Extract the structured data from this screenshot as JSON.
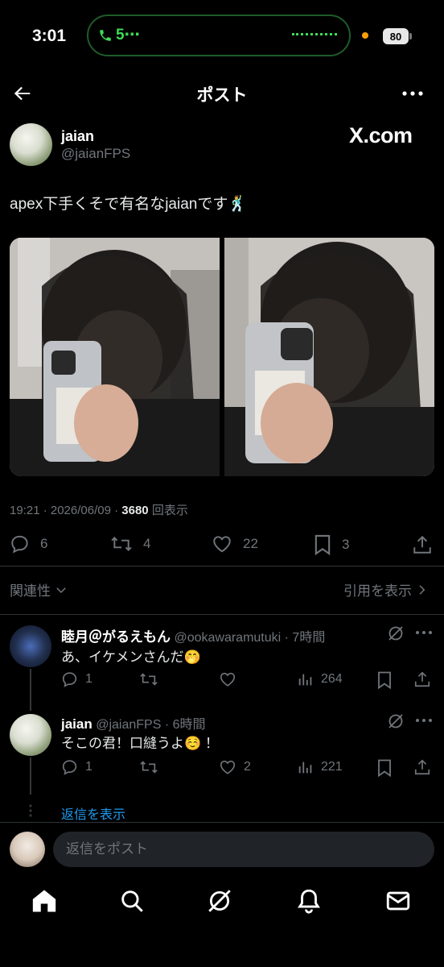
{
  "status_bar": {
    "time": "3:01",
    "call": "5⋯",
    "battery": "80"
  },
  "header": {
    "title": "ポスト"
  },
  "post": {
    "author_name": "jaian",
    "author_handle": "@jaianFPS",
    "watermark": "X.com",
    "text": "apex下手くそで有名なjaianです🕺",
    "timestamp": "19:21 · 2026/06/09 · ",
    "views": "3680",
    "views_label": " 回表示",
    "actions": {
      "replies": "6",
      "reposts": "4",
      "likes": "22",
      "bookmarks": "3"
    }
  },
  "sort": {
    "label": "関連性",
    "quotes_link": "引用を表示"
  },
  "replies": [
    {
      "name": "睦月＠がるえもん",
      "handle": "@ookawaramutuki · 7時間",
      "text": "あ、イケメンさんだ🤭",
      "reply_count": "1",
      "repost_count": "",
      "like_count": "",
      "views": "264"
    },
    {
      "name": "jaian",
      "handle": "@jaianFPS · 6時間",
      "text": "そこの君！口縫うよ☺️ ！",
      "reply_count": "1",
      "repost_count": "",
      "like_count": "2",
      "views": "221"
    }
  ],
  "show_replies": "返信を表示",
  "reply_box": {
    "placeholder": "返信をポスト"
  },
  "colors": {
    "background": "#000000",
    "text": "#e7e9ea",
    "muted": "#71767b",
    "accent": "#1d9bf0",
    "call_green": "#3ddc57"
  },
  "icons": {
    "nav": [
      "home-icon",
      "search-icon",
      "grok-icon",
      "bell-icon",
      "mail-icon"
    ]
  }
}
